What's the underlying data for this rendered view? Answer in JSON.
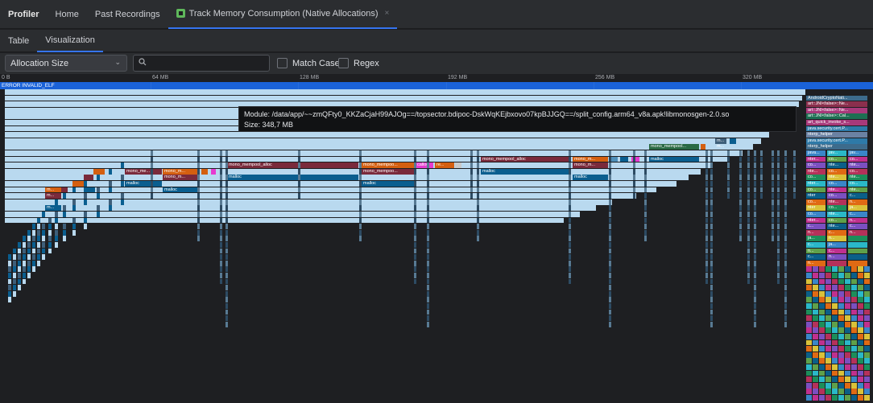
{
  "app": {
    "brand": "Profiler",
    "tabs": [
      {
        "label": "Home"
      },
      {
        "label": "Past Recordings"
      },
      {
        "label": "Track Memory Consumption (Native Allocations)",
        "close": "×"
      }
    ]
  },
  "subtabs": [
    {
      "label": "Table"
    },
    {
      "label": "Visualization"
    }
  ],
  "toolbar": {
    "dropdown_value": "Allocation Size",
    "search_placeholder": "",
    "match_case_label": "Match Case",
    "regex_label": "Regex"
  },
  "axis": {
    "ticks": [
      "0 B",
      "64 MB",
      "128 MB",
      "192 MB",
      "256 MB",
      "320 MB"
    ]
  },
  "error_label": "ERROR INVALID_ELF",
  "tooltip": {
    "module": "Module: /data/app/~~zmQFty0_KKZaCjaH99AJOg==/topsector.bdipoc-DskWqKEjbxovo07kpBJJGQ==/split_config.arm64_v8a.apk!libmonosgen-2.0.so",
    "size": "Size: 348,7 MB"
  },
  "flame_labels": {
    "mono_mempool_alloc": "mono_mempool_alloc",
    "mono_mempoo": "mono_mempoo...",
    "mono_mempool2": "mono_mempool...",
    "mono_m": "mono_m...",
    "mono_me": "mono_me...",
    "m": "m...",
    "malloc": "malloc",
    "calloc": "calloc",
    "re": "re...",
    "right_stack": [
      "AndroidCryptoNati...",
      "art::JNI<false>::Ne...",
      "art::JNI<false>::Ne...",
      "art::JNI<false>::Cal...",
      "art_quick_invoke_s...",
      "java.security.cert.P...",
      "nterp_helper",
      "java.security.cert.P...",
      "nterp_helper"
    ],
    "right_cols": [
      [
        "java...",
        "jav...",
        "jav..."
      ],
      [
        "nter...",
        "co...",
        "co..."
      ],
      [
        "co...",
        "nte...",
        "nte..."
      ],
      [
        "nte...",
        "co...",
        "co..."
      ],
      [
        "co...",
        "nte...",
        "nte..."
      ],
      [
        "nter...",
        "co...",
        "co..."
      ],
      [
        "co...",
        "nte...",
        "nte..."
      ],
      [
        "nter",
        "co...",
        "c..."
      ],
      [
        "co...",
        "nte...",
        "n..."
      ],
      [
        "nter",
        "co...",
        "ja..."
      ],
      [
        "co...",
        "nte...",
        "c..."
      ],
      [
        "nter...",
        "co...",
        "n..."
      ],
      [
        "c...",
        "nte...",
        "c..."
      ],
      [
        "n...",
        "c...",
        "n..."
      ],
      [
        "ja...",
        "n...",
        ""
      ],
      [
        "c...",
        "ja...",
        ""
      ],
      [
        "n...",
        "c...",
        ""
      ],
      [
        "c...",
        "n...",
        ""
      ],
      [
        "n...",
        "",
        ""
      ]
    ]
  },
  "colors": {
    "accent": "#3574f0",
    "error_bar": "#1a62d8",
    "frame_light": "#b9d9ef",
    "frame_dark": "#0a5e8f",
    "mempool": "#7a2a3b",
    "orange": "#d45f10",
    "magenta": "#e63bd0",
    "green": "#2a6a44"
  }
}
